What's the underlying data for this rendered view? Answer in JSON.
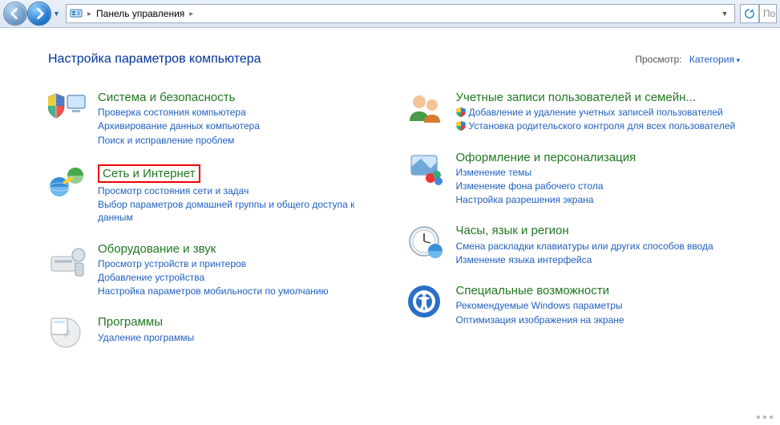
{
  "toolbar": {
    "breadcrumb_root": "Панель управления",
    "search_placeholder": "По"
  },
  "header": {
    "title": "Настройка параметров компьютера",
    "view_label": "Просмотр:",
    "view_value": "Категория"
  },
  "left": [
    {
      "title": "Система и безопасность",
      "icon": "shield-monitor-icon",
      "links": [
        {
          "text": "Проверка состояния компьютера"
        },
        {
          "text": "Архивирование данных компьютера"
        },
        {
          "text": "Поиск и исправление проблем"
        }
      ]
    },
    {
      "title": "Сеть и Интернет",
      "icon": "network-icon",
      "highlight": true,
      "links": [
        {
          "text": "Просмотр состояния сети и задач"
        },
        {
          "text": "Выбор параметров домашней группы и общего доступа к данным"
        }
      ]
    },
    {
      "title": "Оборудование и звук",
      "icon": "hardware-icon",
      "links": [
        {
          "text": "Просмотр устройств и принтеров"
        },
        {
          "text": "Добавление устройства"
        },
        {
          "text": "Настройка параметров мобильности по умолчанию"
        }
      ]
    },
    {
      "title": "Программы",
      "icon": "programs-icon",
      "links": [
        {
          "text": "Удаление программы"
        }
      ]
    }
  ],
  "right": [
    {
      "title": "Учетные записи пользователей и семейн...",
      "icon": "users-icon",
      "links": [
        {
          "text": "Добавление и удаление учетных записей пользователей",
          "shield": true
        },
        {
          "text": "Установка родительского контроля для всех пользователей",
          "shield": true
        }
      ]
    },
    {
      "title": "Оформление и персонализация",
      "icon": "appearance-icon",
      "links": [
        {
          "text": "Изменение темы"
        },
        {
          "text": "Изменение фона рабочего стола"
        },
        {
          "text": "Настройка разрешения экрана"
        }
      ]
    },
    {
      "title": "Часы, язык и регион",
      "icon": "clock-icon",
      "links": [
        {
          "text": "Смена раскладки клавиатуры или других способов ввода"
        },
        {
          "text": "Изменение языка интерфейса"
        }
      ]
    },
    {
      "title": "Специальные возможности",
      "icon": "accessibility-icon",
      "links": [
        {
          "text": "Рекомендуемые Windows параметры"
        },
        {
          "text": "Оптимизация изображения на экране"
        }
      ]
    }
  ]
}
